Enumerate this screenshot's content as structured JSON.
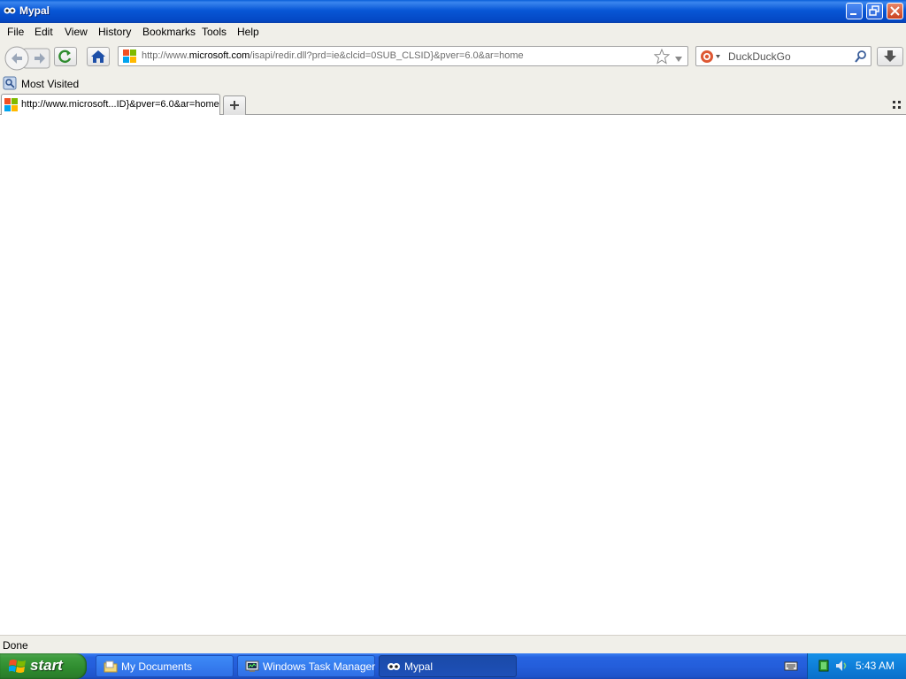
{
  "window": {
    "title": "Mypal"
  },
  "menubar": {
    "items": [
      {
        "label": "File"
      },
      {
        "label": "Edit"
      },
      {
        "label": "View"
      },
      {
        "label": "History"
      },
      {
        "label": "Bookmarks"
      },
      {
        "label": "Tools"
      },
      {
        "label": "Help"
      }
    ]
  },
  "navbar": {
    "url_prefix": "http://www.",
    "url_domain": "microsoft.com",
    "url_path": "/isapi/redir.dll?prd=ie&clcid=0SUB_CLSID}&pver=6.0&ar=home",
    "search_placeholder": "DuckDuckGo"
  },
  "bookmarks": {
    "items": [
      {
        "label": "Most Visited"
      }
    ]
  },
  "tabs": [
    {
      "title": "http://www.microsoft...ID}&pver=6.0&ar=home"
    }
  ],
  "status": {
    "text": "Done"
  },
  "taskbar": {
    "start_label": "start",
    "tasks": [
      {
        "label": "My Documents"
      },
      {
        "label": "Windows Task Manager"
      },
      {
        "label": "Mypal"
      }
    ],
    "clock": "5:43 AM"
  },
  "colors": {
    "titlebar": "#0857d6",
    "taskbar": "#245edb",
    "start": "#3c9a3c",
    "chrome": "#f0efe9"
  }
}
